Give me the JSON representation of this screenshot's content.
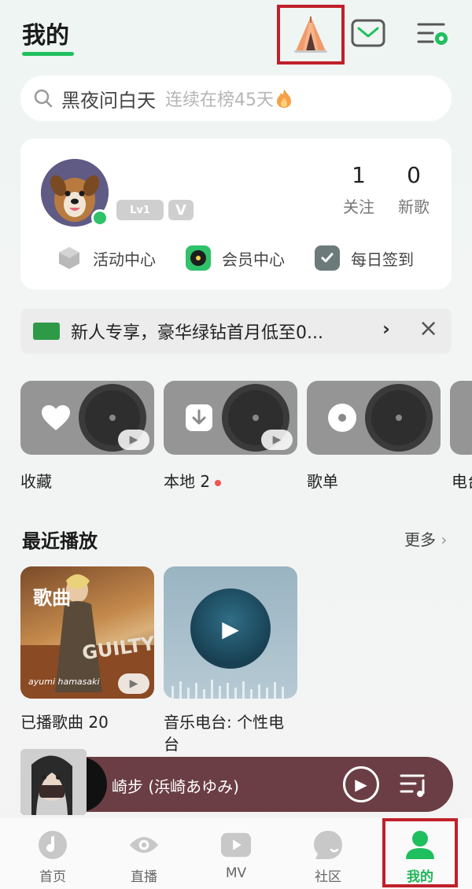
{
  "header": {
    "title": "我的"
  },
  "search": {
    "query": "黑夜问白天",
    "hint": "连续在榜45天"
  },
  "profile": {
    "level": "Lv1",
    "vip_badge": "V",
    "stats": [
      {
        "value": "1",
        "label": "关注"
      },
      {
        "value": "0",
        "label": "新歌"
      }
    ],
    "quick_links": [
      {
        "label": "活动中心"
      },
      {
        "label": "会员中心"
      },
      {
        "label": "每日签到"
      }
    ]
  },
  "promo": {
    "text": "新人专享，豪华绿钻首月低至0...",
    "chevron": "›",
    "close": "×"
  },
  "tiles": [
    {
      "label": "收藏"
    },
    {
      "label": "本地 2"
    },
    {
      "label": "歌单"
    },
    {
      "label": "电台"
    }
  ],
  "recent": {
    "title": "最近播放",
    "more": "更多",
    "items": [
      {
        "tag": "歌曲",
        "cover_text": "GUILTY",
        "cover_artist": "ayumi hamasaki",
        "label": "已播歌曲 20"
      },
      {
        "label_line1": "音乐电台: 个性电",
        "label_line2": "台"
      }
    ]
  },
  "player": {
    "now_playing": "崎步 (浜崎あゆみ)"
  },
  "tabbar": [
    {
      "label": "首页"
    },
    {
      "label": "直播"
    },
    {
      "label": "MV"
    },
    {
      "label": "社区"
    },
    {
      "label": "我的"
    }
  ],
  "colors": {
    "accent": "#20c05e",
    "highlight_box": "#c0202a",
    "player_bg": "#6a3e44"
  }
}
